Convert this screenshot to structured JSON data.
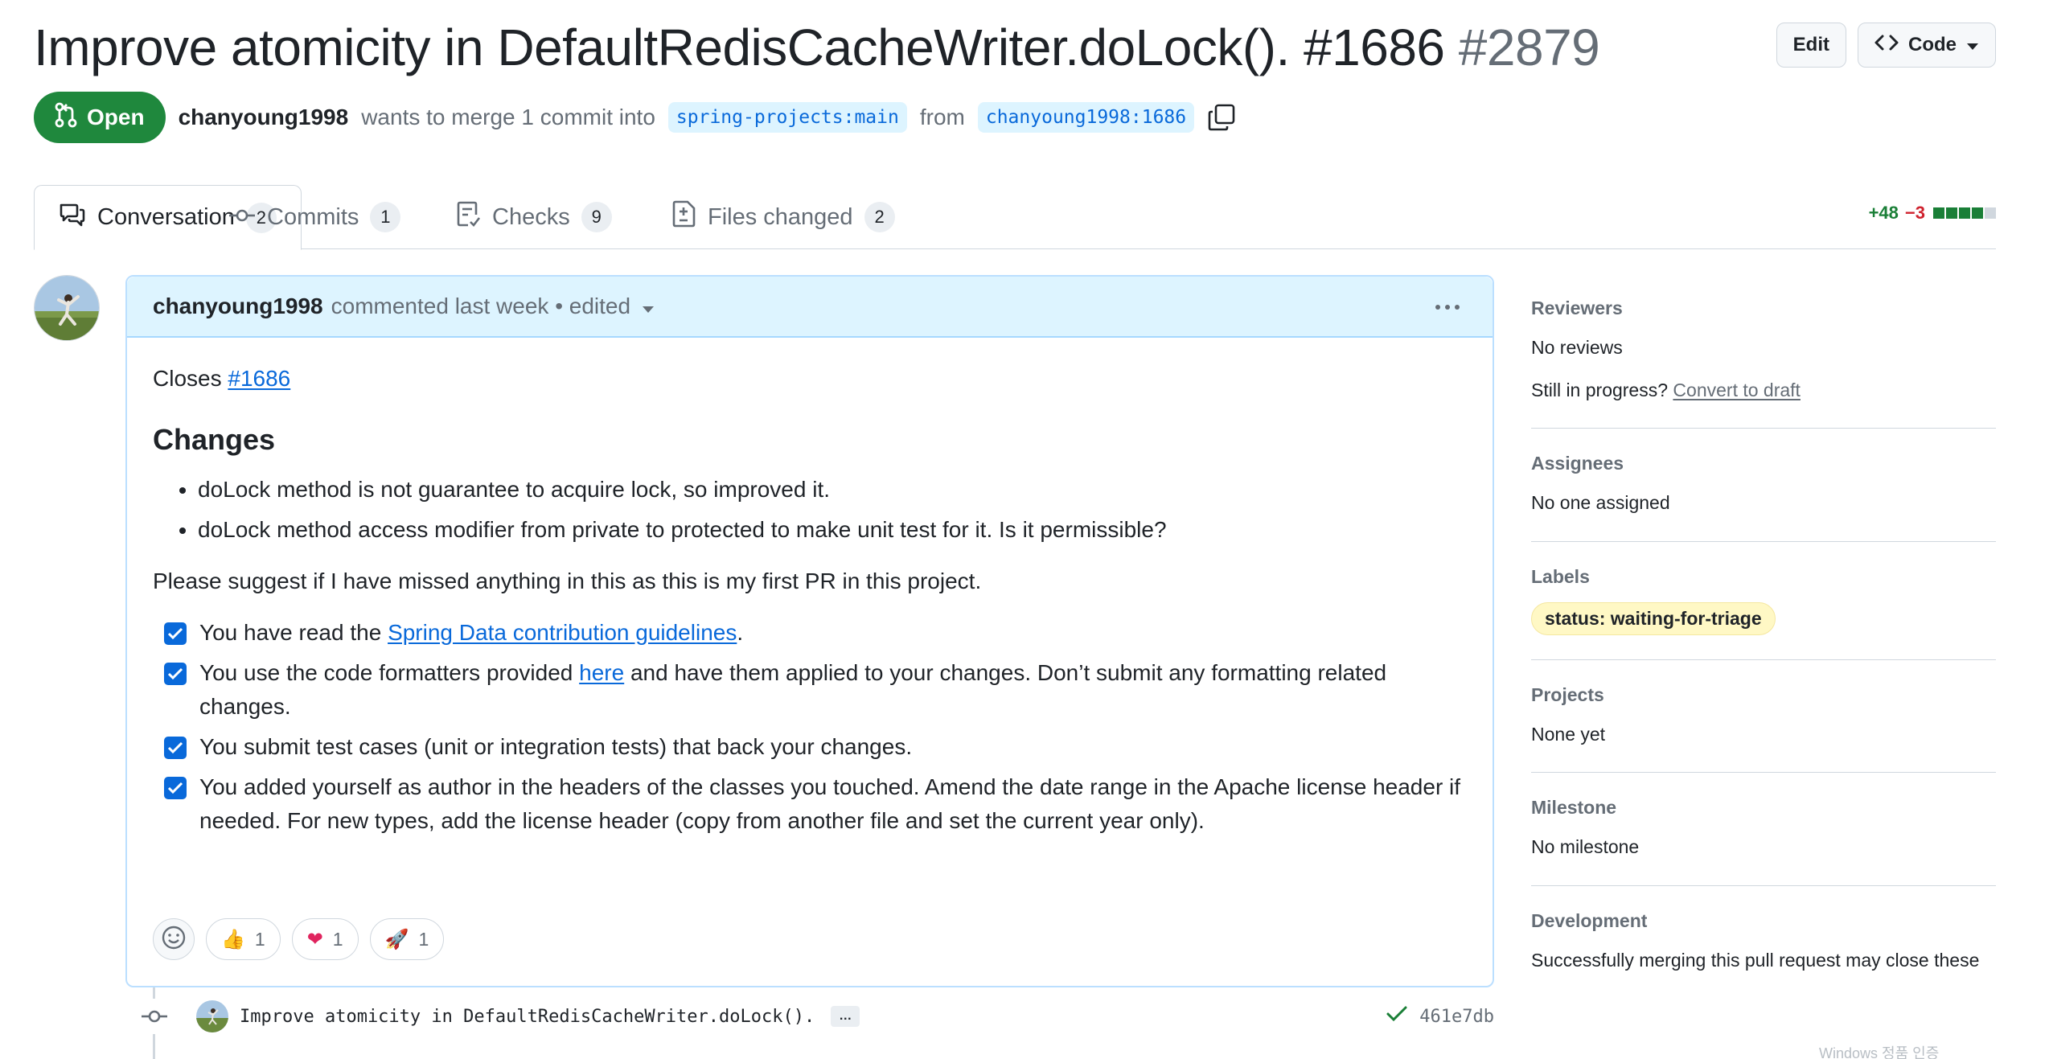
{
  "header": {
    "title": "Improve atomicity in DefaultRedisCacheWriter.doLock(). #1686",
    "number": "#2879",
    "edit_label": "Edit",
    "code_label": "Code",
    "state": "Open",
    "author": "chanyoung1998",
    "merge_text": "wants to merge 1 commit into",
    "base_branch": "spring-projects:main",
    "from_text": "from",
    "head_branch": "chanyoung1998:1686"
  },
  "tabs": [
    {
      "label": "Conversation",
      "count": "2"
    },
    {
      "label": "Commits",
      "count": "1"
    },
    {
      "label": "Checks",
      "count": "9"
    },
    {
      "label": "Files changed",
      "count": "2"
    }
  ],
  "diffstat": {
    "additions": "+48",
    "deletions": "−3"
  },
  "comment": {
    "author": "chanyoung1998",
    "meta": "commented last week • edited",
    "closes_text": "Closes",
    "closes_link": "#1686",
    "heading": "Changes",
    "bullets": [
      "doLock method is not guarantee to acquire lock, so improved it.",
      "doLock method access modifier from private to protected to make unit test for it. Is it permissible?"
    ],
    "paragraph": "Please suggest if I have missed anything in this as this is my first PR in this project.",
    "tasks": [
      {
        "pre": "You have read the ",
        "link": "Spring Data contribution guidelines",
        "post": "."
      },
      {
        "pre": "You use the code formatters provided ",
        "link": "here",
        "post": " and have them applied to your changes. Don’t submit any formatting related changes."
      },
      {
        "pre": "You submit test cases (unit or integration tests) that back your changes.",
        "link": "",
        "post": ""
      },
      {
        "pre": "You added yourself as author in the headers of the classes you touched. Amend the date range in the Apache license header if needed. For new types, add the license header (copy from another file and set the current year only).",
        "link": "",
        "post": ""
      }
    ],
    "reactions": [
      {
        "emoji": "👍",
        "count": "1"
      },
      {
        "emoji": "❤",
        "count": "1"
      },
      {
        "emoji": "🚀",
        "count": "1"
      }
    ]
  },
  "commit": {
    "message": "Improve atomicity in DefaultRedisCacheWriter.doLock().",
    "ellipsis": "…",
    "sha": "461e7db"
  },
  "sidebar": {
    "reviewers_title": "Reviewers",
    "reviewers_value": "No reviews",
    "in_progress_text": "Still in progress?",
    "convert_link": "Convert to draft",
    "assignees_title": "Assignees",
    "assignees_value": "No one assigned",
    "labels_title": "Labels",
    "label": "status: waiting-for-triage",
    "projects_title": "Projects",
    "projects_value": "None yet",
    "milestone_title": "Milestone",
    "milestone_value": "No milestone",
    "development_title": "Development",
    "development_value": "Successfully merging this pull request may close these"
  },
  "watermark": "Windows 정품 인증",
  "colors": {
    "open_green": "#1f883d",
    "link_blue": "#0969da",
    "comment_header_bg": "#ddf4ff",
    "label_bg": "#fff8c5",
    "additions": "#1a7f37",
    "deletions": "#cf222e"
  }
}
